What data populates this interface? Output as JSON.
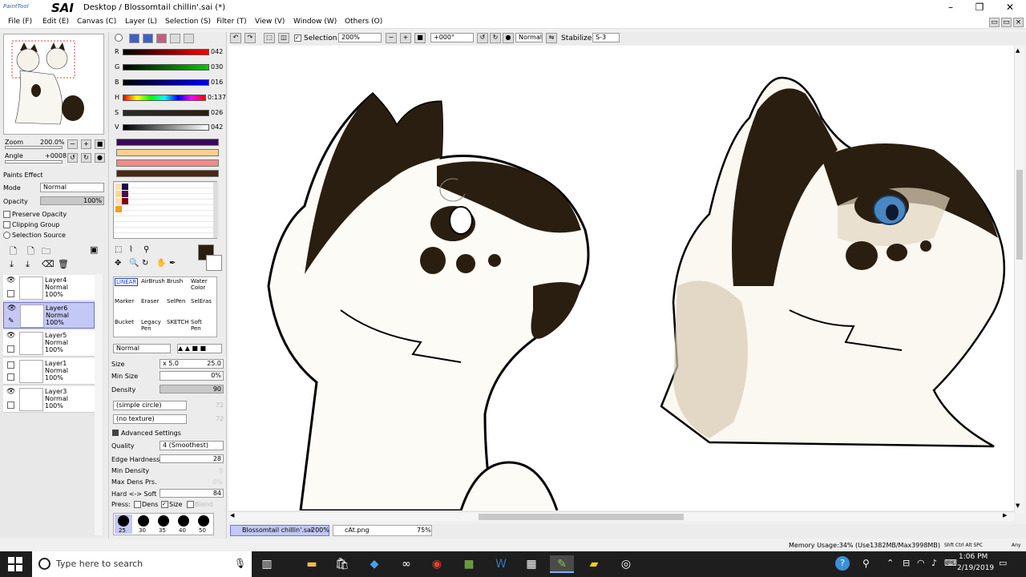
{
  "app": {
    "logo_small": "PaintTool",
    "logo_big": "SAI",
    "title": "Desktop / Blossomtail chillin'.sai (*)"
  },
  "menu": [
    "File (F)",
    "Edit (E)",
    "Canvas (C)",
    "Layer (L)",
    "Selection (S)",
    "Filter (T)",
    "View (V)",
    "Window (W)",
    "Others (O)"
  ],
  "navigator": {
    "zoom_label": "Zoom",
    "zoom_value": "200.0%",
    "angle_label": "Angle",
    "angle_value": "+0008"
  },
  "paints_effect": "Paints Effect",
  "layer_props": {
    "mode_label": "Mode",
    "mode_value": "Normal",
    "opacity_label": "Opacity",
    "opacity_value": "100%",
    "preserve_opacity": "Preserve Opacity",
    "clipping_group": "Clipping Group",
    "selection_source": "Selection Source"
  },
  "layers": [
    {
      "name": "Layer4",
      "mode": "Normal",
      "opacity": "100%",
      "selected": false
    },
    {
      "name": "Layer6",
      "mode": "Normal",
      "opacity": "100%",
      "selected": true
    },
    {
      "name": "Layer5",
      "mode": "Normal",
      "opacity": "100%",
      "selected": false
    },
    {
      "name": "Layer1",
      "mode": "Normal",
      "opacity": "100%",
      "selected": false
    },
    {
      "name": "Layer3",
      "mode": "Normal",
      "opacity": "100%",
      "selected": false
    }
  ],
  "color": {
    "r_label": "R",
    "r": "042",
    "g_label": "G",
    "g": "030",
    "b_label": "B",
    "b": "016",
    "h_label": "H",
    "h": "0:137",
    "s_label": "S",
    "s": "026",
    "v_label": "V",
    "v": "042",
    "current": "#2a1e10"
  },
  "tools": {
    "row1": [
      "LINEAR",
      "AirBrush",
      "Brush",
      "Water Color"
    ],
    "row2": [
      "Marker",
      "Eraser",
      "SelPen",
      "SelEras"
    ],
    "row3": [
      "Bucket",
      "Legacy Pen",
      "SKETCH",
      "Soft Pen"
    ]
  },
  "brush": {
    "blend_mode": "Normal",
    "size_label": "Size",
    "size_mult": "x 5.0",
    "size_value": "25.0",
    "min_size_label": "Min Size",
    "min_size_value": "0%",
    "density_label": "Density",
    "density_value": "90",
    "shape": "(simple circle)",
    "shape_value": "72",
    "texture": "(no texture)",
    "texture_value": "72",
    "advanced": "Advanced Settings",
    "quality_label": "Quality",
    "quality_value": "4 (Smoothest)",
    "edge_label": "Edge Hardness",
    "edge_value": "28",
    "min_density_label": "Min Density",
    "min_density_value": "0",
    "max_dens_label": "Max Dens Prs.",
    "max_dens_value": "0%",
    "hard_soft_label": "Hard <-> Soft",
    "hard_soft_value": "84",
    "press_label": "Press:",
    "dens": "Dens",
    "size": "Size",
    "blend": "Blend",
    "sizes": [
      "25",
      "30",
      "35",
      "40",
      "50"
    ]
  },
  "toolbar": {
    "selection_label": "Selection",
    "zoom": "200%",
    "angle": "+000°",
    "mode": "Normal",
    "stabilizer_label": "Stabilizer",
    "stabilizer_value": "S-3"
  },
  "tabs": [
    {
      "name": "Blossomtail chillin'.sai",
      "zoom": "200%"
    },
    {
      "name": "cAt.png",
      "zoom": "75%"
    }
  ],
  "status": {
    "memory": "Memory Usage:34% (Use1382MB/Max3998MB)",
    "keys": "Shft Ctrl Alt SPC",
    "any": "Any"
  },
  "taskbar": {
    "search_placeholder": "Type here to search",
    "time": "1:06 PM",
    "date": "2/19/2019"
  }
}
